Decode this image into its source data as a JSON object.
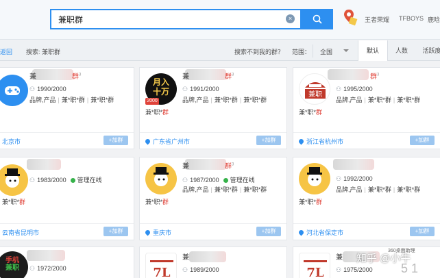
{
  "search": {
    "value": "兼职群",
    "clear_icon": "close-icon",
    "button_icon": "search-icon"
  },
  "header_links": [
    "王者荣耀",
    "TFBOYS",
    "鹿晗"
  ],
  "filter": {
    "back": "返回",
    "query_label": "搜索: 兼职群",
    "not_found": "搜索不到我的群？",
    "range_label": "范围：",
    "range_value": "全国",
    "tabs": [
      "默认",
      "人数",
      "活跃度"
    ]
  },
  "cards": [
    {
      "name_prefix": "兼",
      "name_suffix": "群",
      "level_sup": "3",
      "members": "1990/2000",
      "online": "",
      "tags": [
        "品牌,产品",
        "兼*职*群",
        "兼*职*群"
      ],
      "second": [
        "",
        ""
      ],
      "city": "北京市",
      "join": "+加群",
      "avatar": "gamepad-icon"
    },
    {
      "name_prefix": "兼",
      "name_suffix": "群",
      "level_sup": "3",
      "members": "1991/2000",
      "online": "",
      "tags": [
        "品牌,产品",
        "兼*职*群",
        "兼*职*群"
      ],
      "second": [
        "兼*职*",
        "群"
      ],
      "city": "广东省广州市",
      "join": "+加群",
      "avatar": "月入十万",
      "level": "2000"
    },
    {
      "name_prefix": "",
      "name_suffix": "群",
      "level_sup": "3",
      "members": "1995/2000",
      "online": "",
      "tags": [
        "品牌,产品",
        "兼*职*群",
        "兼*职*群"
      ],
      "second": [
        "兼*职*",
        "群"
      ],
      "city": "浙江省杭州市",
      "join": "+加群",
      "avatar": "兼职"
    },
    {
      "name_prefix": "",
      "name_suffix": "",
      "level_sup": "",
      "members": "1983/2000",
      "online": "管理在线",
      "tags": [
        "品牌,产品",
        "兼*职*群",
        "兼*职*群"
      ],
      "second": [
        "兼*职*",
        "群"
      ],
      "city": "云南省昆明市",
      "join": "+加群",
      "avatar": "cartoon-avatar"
    },
    {
      "name_prefix": "兼",
      "name_suffix": "群",
      "level_sup": "3",
      "members": "1987/2000",
      "online": "管理在线",
      "tags": [
        "品牌,产品",
        "兼*职*群",
        "兼*职*群"
      ],
      "second": [
        "兼*职*",
        "群"
      ],
      "city": "重庆市",
      "join": "+加群",
      "avatar": "cartoon-avatar"
    },
    {
      "name_prefix": "",
      "name_suffix": "",
      "level_sup": "",
      "members": "1992/2000",
      "online": "",
      "tags": [
        "品牌,产品",
        "兼*职*群",
        "兼*职*群"
      ],
      "second": [
        "兼*职*",
        "群"
      ],
      "city": "河北省保定市",
      "join": "+加群",
      "avatar": "cartoon-avatar"
    },
    {
      "name_prefix": "",
      "name_suffix": "",
      "level_sup": "",
      "members": "1972/2000",
      "online": "",
      "tags": [],
      "second": [
        "",
        ""
      ],
      "city": "",
      "join": "",
      "avatar": "手机兼职"
    },
    {
      "name_prefix": "兼",
      "name_suffix": "",
      "level_sup": "",
      "members": "1989/2000",
      "online": "",
      "tags": [],
      "second": [
        "",
        ""
      ],
      "city": "",
      "join": "",
      "avatar": "logo"
    },
    {
      "name_prefix": "兼",
      "name_suffix": "",
      "level_sup": "",
      "members": "1975/2000",
      "online": "",
      "tags": [],
      "second": [
        "",
        ""
      ],
      "city": "",
      "join": "",
      "avatar": "logo"
    }
  ],
  "watermark": {
    "text": "知乎 @小牛",
    "small": "360桌面助理",
    "big": "5 1"
  }
}
